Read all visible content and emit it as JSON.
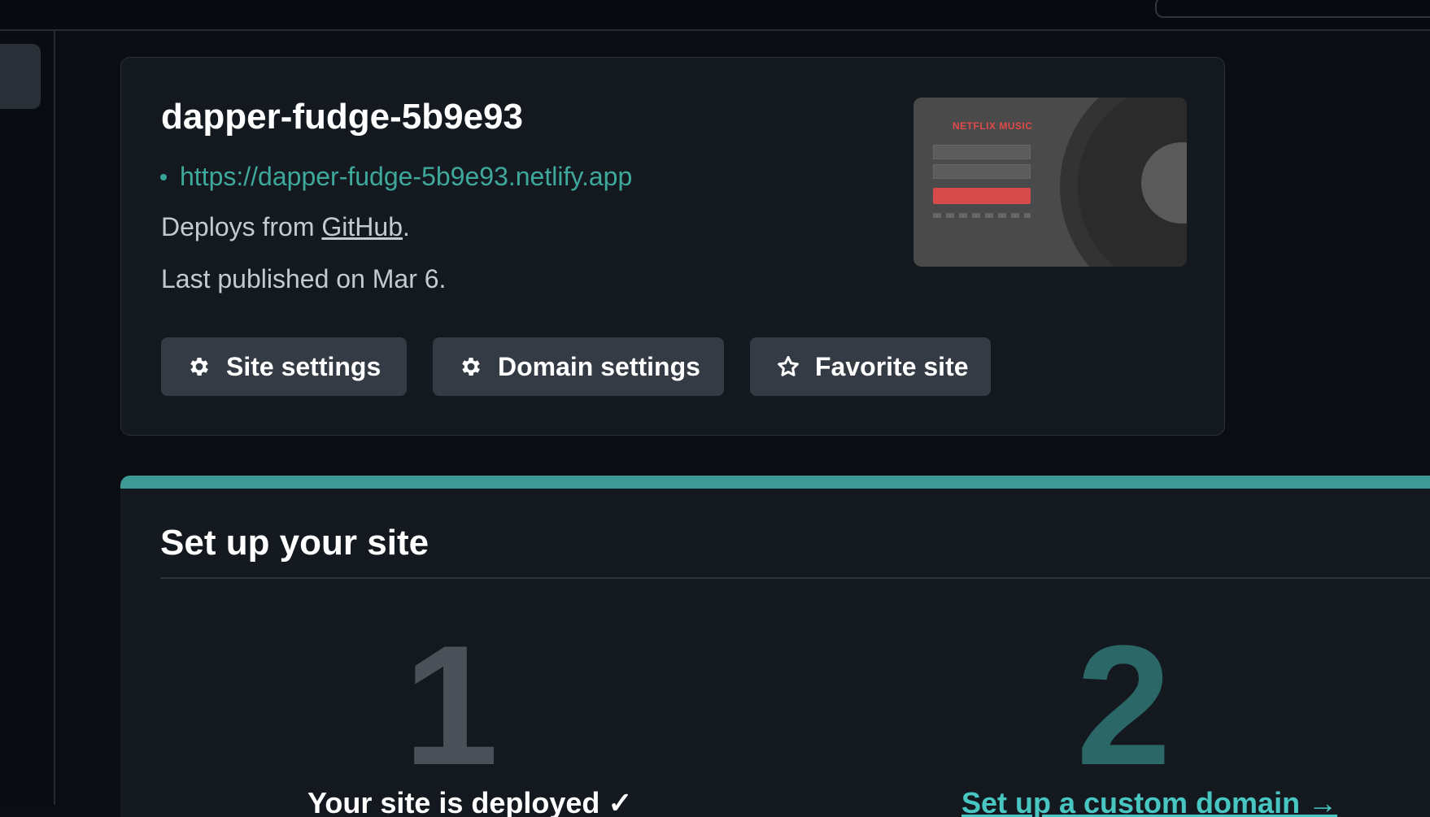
{
  "site": {
    "name": "dapper-fudge-5b9e93",
    "url": "https://dapper-fudge-5b9e93.netlify.app",
    "deploys_prefix": "Deploys from",
    "deploys_source": "GitHub",
    "deploys_suffix": ".",
    "published": "Last published on Mar 6.",
    "preview_brand": "NETFLIX MUSIC"
  },
  "buttons": {
    "site_settings": "Site settings",
    "domain_settings": "Domain settings",
    "favorite": "Favorite site"
  },
  "icons": {
    "site_settings": "gear-icon",
    "domain_settings": "gear-icon",
    "favorite": "star-icon"
  },
  "setup": {
    "title": "Set up your site",
    "steps": [
      {
        "number": "1",
        "label": "Your site is deployed ✓"
      },
      {
        "number": "2",
        "label": "Set up a custom domain →"
      }
    ]
  },
  "colors": {
    "accent": "#3ea89b",
    "card_bg": "#141920",
    "button_bg": "#353b44",
    "page_bg": "#0a0d12"
  }
}
